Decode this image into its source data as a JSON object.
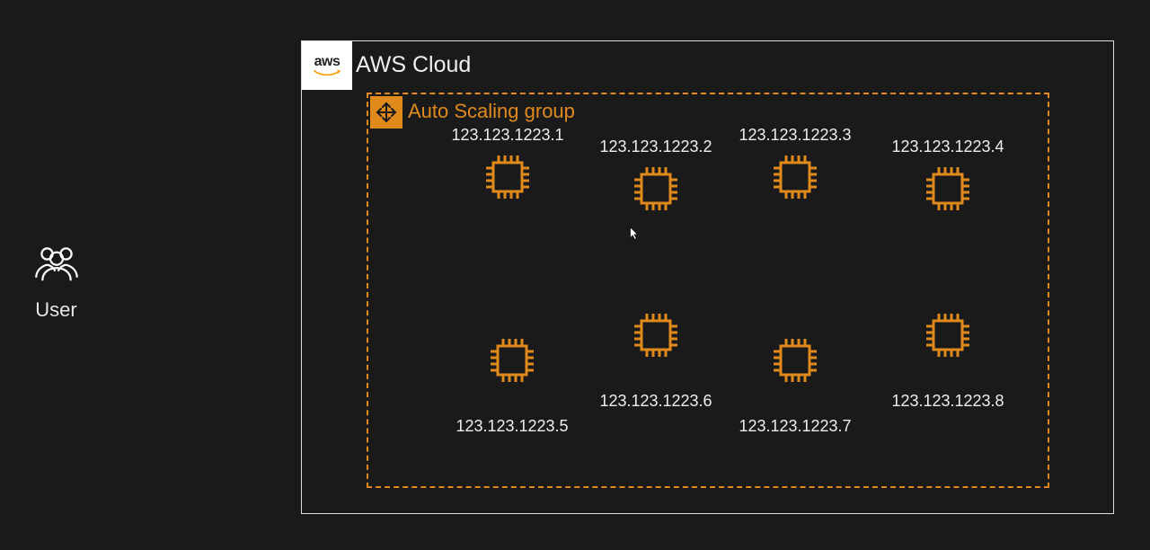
{
  "user": {
    "label": "User"
  },
  "cloud": {
    "title": "AWS Cloud",
    "logo_text": "aws"
  },
  "asg": {
    "title": "Auto Scaling group"
  },
  "instances": {
    "i1": {
      "ip": "123.123.1223.1"
    },
    "i2": {
      "ip": "123.123.1223.2"
    },
    "i3": {
      "ip": "123.123.1223.3"
    },
    "i4": {
      "ip": "123.123.1223.4"
    },
    "i5": {
      "ip": "123.123.1223.5"
    },
    "i6": {
      "ip": "123.123.1223.6"
    },
    "i7": {
      "ip": "123.123.1223.7"
    },
    "i8": {
      "ip": "123.123.1223.8"
    }
  },
  "colors": {
    "accent": "#e08a1c",
    "bg": "#1a1a1a"
  }
}
